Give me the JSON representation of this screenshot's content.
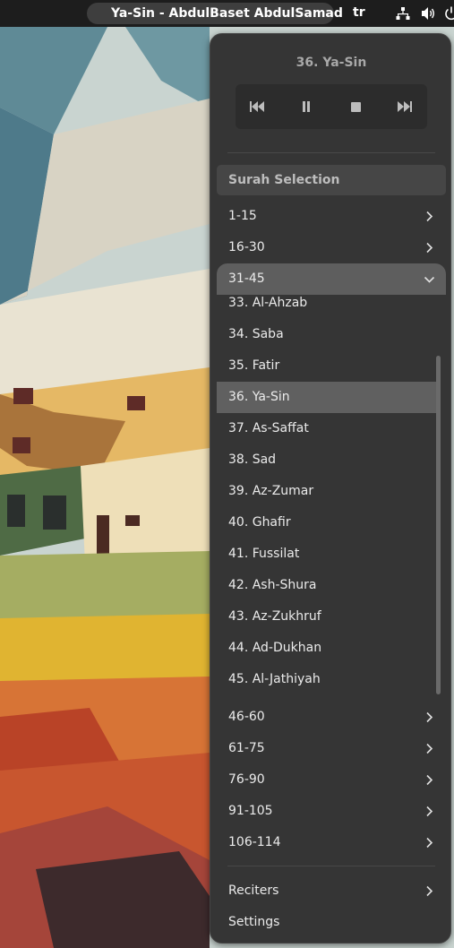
{
  "topbar": {
    "indicator_title": "Ya-Sin - AbdulBaset AbdulSamad",
    "language": "tr",
    "icons": [
      "book-icon",
      "network-icon",
      "volume-icon",
      "power-icon"
    ]
  },
  "menu": {
    "now_playing": "36. Ya-Sin",
    "controls": [
      "previous-icon",
      "pause-icon",
      "stop-icon",
      "next-icon"
    ],
    "section_header": "Surah Selection",
    "groups_before": [
      "1-15",
      "16-30"
    ],
    "expanded_group": "31-45",
    "surahs": [
      "33. Al-Ahzab",
      "34. Saba",
      "35. Fatir",
      "36. Ya-Sin",
      "37. As-Saffat",
      "38. Sad",
      "39. Az-Zumar",
      "40. Ghafir",
      "41. Fussilat",
      "42. Ash-Shura",
      "43. Az-Zukhruf",
      "44. Ad-Dukhan",
      "45. Al-Jathiyah"
    ],
    "active_surah": "36. Ya-Sin",
    "groups_after": [
      "46-60",
      "61-75",
      "76-90",
      "91-105",
      "106-114"
    ],
    "reciters_label": "Reciters",
    "settings_label": "Settings"
  },
  "colors": {
    "menu_bg": "#353535",
    "highlight": "#606060",
    "topbar_bg": "#1d1d1d"
  }
}
